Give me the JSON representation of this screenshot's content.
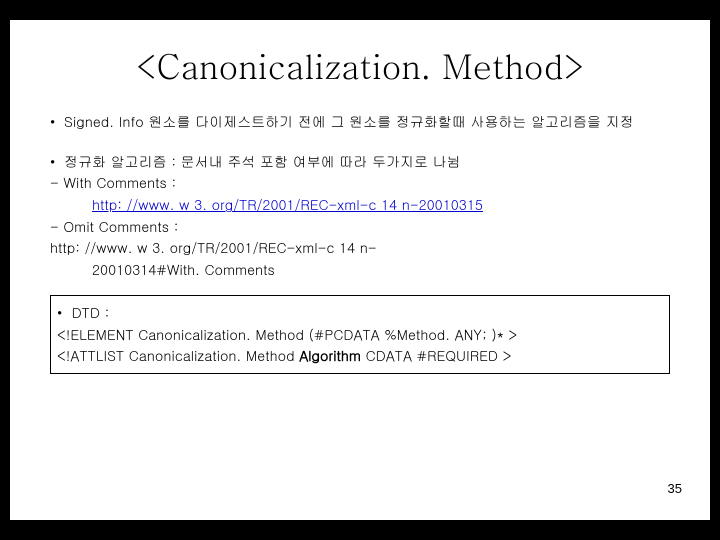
{
  "title": "<Canonicalization. Method>",
  "b1_text": "Signed. Info 원소를 다이제스트하기 전에 그 원소를 정규화할때 사용하는 알고리즘을 지정",
  "b2_text": "정규화 알고리즘 : 문서내 주석 포함 여부에 따라 두가지로 나뉨",
  "with_label": "- With Comments :",
  "with_url": "http: //www. w 3. org/TR/2001/REC-xml-c 14 n-20010315",
  "omit_label": "- Omit Comments :",
  "omit_url_line1": "http: //www. w 3. org/TR/2001/REC-xml-c 14 n-",
  "omit_url_line2": "20010314#With. Comments",
  "dtd_label": "DTD :",
  "dtd_elem": "<!ELEMENT Canonicalization. Method (#PCDATA %Method. ANY; )* >",
  "dtd_att_pre": "<!ATTLIST Canonicalization. Method ",
  "dtd_att_bold": "Algorithm",
  "dtd_att_post": " CDATA #REQUIRED >",
  "pagenum": "35",
  "bullet": "•"
}
